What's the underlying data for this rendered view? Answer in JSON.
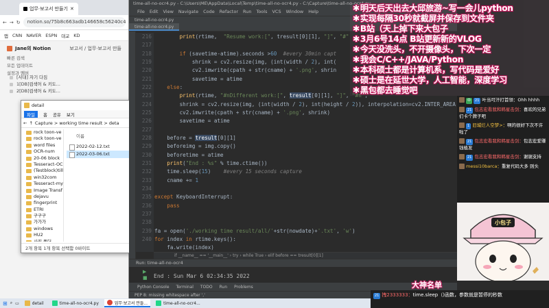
{
  "browser": {
    "tab_title": "업무·보고서 만들기",
    "url": "notion.so/75b8c663adb146658c56240c48a",
    "bookmarks": [
      "앱",
      "CNN",
      "NAVER",
      "ESPN",
      "대교",
      "KD"
    ],
    "workspace": "Jane의 Notion",
    "breadcrumb": "보고서 / 업무·보고서 만들",
    "side_items": [
      "빠른 검색",
      "모든 업데이트",
      "설정과 멤버"
    ],
    "page_list": [
      "[사내] 자기 다짐",
      "1[DB]검색어 & 키도...",
      "2[DB]검색어 & 키도...",
      "보고서",
      "업무·보고서 만들기"
    ]
  },
  "explorer": {
    "title": "detail",
    "ribbon": [
      "파일",
      "홈",
      "공유",
      "보기"
    ],
    "path": "Capture > working time result > deta",
    "nav_items": [
      "rock toon-ve",
      "rock toon-ve",
      "word files",
      "OCR-num",
      "20-06 block",
      "Tesseract-OC",
      "(Testblock)till",
      "win32com",
      "Tesseract-my",
      "Image Transf",
      "dejavu",
      "fingerprint",
      "ETRI",
      "구구구",
      "가가가",
      "windows",
      "HU2",
      "사진 폴더",
      "로딩 없는",
      "내 PC"
    ],
    "column_header": "이름",
    "files": [
      "2022-02-12.txt",
      "2022-03-06.txt"
    ],
    "status": "2개 항목 1개 항목 선택함 0바이트"
  },
  "ide": {
    "title": "time-all-no-ocr4.py - C:\\Users\\ME\\AppData\\Local\\Temp\\time-all-no-ocr4.py - C:\\Capture\\time-all-no-ocr4.py",
    "menu": [
      "File",
      "Edit",
      "View",
      "Navigate",
      "Code",
      "Refactor",
      "Run",
      "Tools",
      "VCS",
      "Window",
      "Help"
    ],
    "project_crumb": "time-all-no-ocr4.py",
    "tab": "time-all-no-ocr4.py",
    "line_numbers": [
      "216",
      "217",
      "218",
      "219",
      "220",
      "221",
      "222",
      "223",
      "224",
      "225",
      "226",
      "227",
      "228",
      "229",
      "230",
      "231",
      "232",
      "233",
      "234",
      "235",
      "236",
      "237",
      "238",
      "239",
      "240"
    ],
    "editor_breadcrumb": "if __name__ == '__main__'  ›  try  ›  while True  ›  elif before == tresult[0][1]",
    "run_tab": "Run:  time-all-no-ocr4",
    "run_output": "End : Sun Mar  6 02:34:35 2022",
    "bottom_tools": [
      "Python Console",
      "Terminal",
      "TODO",
      "Run",
      "Problems"
    ],
    "status_line": "PEP 8: missing whitespace after ','"
  },
  "overlay": {
    "lines": [
      "明天后天出去大邱旅游~写一会儿python",
      "实现每隔30秒就截屏并保存到文件夹",
      "B站（天上掉下来大包子",
      "3月6号14点 B站更新新的VLOG",
      "今天没洗头，不开摄像头，下次一定",
      "我会C/C++/JAVA/Python",
      "本科硕士都是计算机系，写代码是爱好",
      "硕士是在延世大学，人工智能，深度学习",
      "黑包都去睡觉吧"
    ]
  },
  "chat": {
    "messages": [
      {
        "badge": "中",
        "level": "21",
        "user": "",
        "text": "叶当可汗打首领：Ohh hhhh"
      },
      {
        "badge": "",
        "level": "21",
        "user": "包志宏看我和韩星击剑：",
        "text": "喜欢的兄弟们卡个牌子吧"
      },
      {
        "badge": "",
        "level": "1",
        "user": "旧城烂人空梦>：",
        "text": "啊的很好下次不许啦了"
      },
      {
        "badge": "",
        "level": "21",
        "user": "包志宏看我和韩星击剑：",
        "text": "包志宏爱赚钱植发"
      },
      {
        "badge": "",
        "level": "21",
        "user": "包志宏看我和韩星击剑：",
        "text": "谢谢支持"
      },
      {
        "badge": "",
        "level": "",
        "user": "messi10barca：",
        "text": "重复代码大多 则头"
      }
    ]
  },
  "webcam": {
    "sign": "小包子"
  },
  "nameplate": "大神名单",
  "danmu": {
    "level": "21",
    "user": "拽2333333：",
    "text": "time.sleep（)函数，参数就是暂停的秒数"
  },
  "taskbar": {
    "items": [
      "detail",
      "time-all-no-ocr4.py",
      "업무·보고서 만들...",
      "time-all-no-ocr4..."
    ]
  }
}
